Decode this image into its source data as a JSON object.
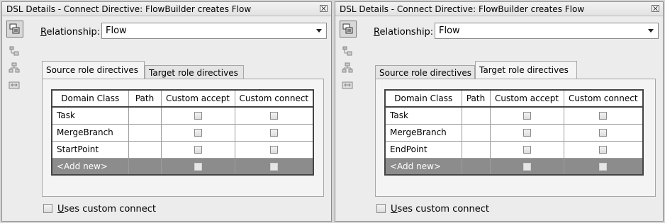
{
  "panels": [
    {
      "title": "DSL Details - Connect Directive: FlowBuilder creates Flow",
      "relationship_label": "Relationship:",
      "relationship_value": "Flow",
      "tabs": [
        {
          "label": "Source role directives",
          "selected": true
        },
        {
          "label": "Target role directives",
          "selected": false
        }
      ],
      "columns": [
        "Domain Class",
        "Path",
        "Custom accept",
        "Custom connect"
      ],
      "rows": [
        {
          "domain_class": "Task",
          "path": "",
          "custom_accept": false,
          "custom_connect": false
        },
        {
          "domain_class": "MergeBranch",
          "path": "",
          "custom_accept": false,
          "custom_connect": false
        },
        {
          "domain_class": "StartPoint",
          "path": "",
          "custom_accept": false,
          "custom_connect": false
        }
      ],
      "add_new_label": "<Add new>",
      "uses_custom_connect_label": "Uses custom connect",
      "uses_custom_connect_checked": false
    },
    {
      "title": "DSL Details - Connect Directive: FlowBuilder creates Flow",
      "relationship_label": "Relationship:",
      "relationship_value": "Flow",
      "tabs": [
        {
          "label": "Source role directives",
          "selected": false
        },
        {
          "label": "Target role directives",
          "selected": true
        }
      ],
      "columns": [
        "Domain Class",
        "Path",
        "Custom accept",
        "Custom connect"
      ],
      "rows": [
        {
          "domain_class": "Task",
          "path": "",
          "custom_accept": false,
          "custom_connect": false
        },
        {
          "domain_class": "MergeBranch",
          "path": "",
          "custom_accept": false,
          "custom_connect": false
        },
        {
          "domain_class": "EndPoint",
          "path": "",
          "custom_accept": false,
          "custom_connect": false
        }
      ],
      "add_new_label": "<Add new>",
      "uses_custom_connect_label": "Uses custom connect",
      "uses_custom_connect_checked": false
    }
  ],
  "toolbar_icons": [
    "dsl-details-icon",
    "element-mappings-icon",
    "hierarchy-icon",
    "connect-icon"
  ]
}
